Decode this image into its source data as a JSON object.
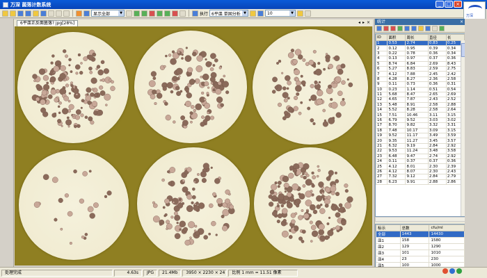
{
  "window": {
    "title": "万深 菌落计数系统",
    "logo_text": "万深"
  },
  "toolbar": {
    "mode_dropdown": "显示全部",
    "run_label": "执行",
    "detect_dropdown": "6平皿 单固分析",
    "num_input": "10"
  },
  "document_tab": {
    "label": "6平皿正反面菌落? jpg[28%]"
  },
  "right_panel": {
    "title": "统计",
    "table1": {
      "columns": [
        "ID",
        "面积",
        "周长",
        "直径",
        "长"
      ],
      "rows": [
        [
          "1",
          "0.53",
          "2.74",
          "0.83",
          "0.25"
        ],
        [
          "2",
          "0.12",
          "0.95",
          "0.39",
          "0.34"
        ],
        [
          "3",
          "0.22",
          "0.78",
          "0.36",
          "0.34"
        ],
        [
          "4",
          "0.13",
          "0.97",
          "0.37",
          "0.36"
        ],
        [
          "5",
          "8.74",
          "6.84",
          "2.69",
          "8.43"
        ],
        [
          "6",
          "5.27",
          "8.83",
          "2.59",
          "2.75"
        ],
        [
          "7",
          "4.12",
          "7.88",
          "2.45",
          "2.42"
        ],
        [
          "8",
          "4.28",
          "8.27",
          "2.36",
          "2.58"
        ],
        [
          "9",
          "0.11",
          "0.73",
          "0.36",
          "0.31"
        ],
        [
          "10",
          "0.23",
          "1.14",
          "0.51",
          "0.54"
        ],
        [
          "11",
          "5.68",
          "8.47",
          "2.65",
          "2.69"
        ],
        [
          "12",
          "4.65",
          "7.87",
          "2.43",
          "2.52"
        ],
        [
          "13",
          "5.48",
          "8.91",
          "2.58",
          "2.88"
        ],
        [
          "14",
          "5.52",
          "8.28",
          "2.58",
          "2.64"
        ],
        [
          "15",
          "7.51",
          "10.46",
          "3.11",
          "3.15"
        ],
        [
          "16",
          "6.79",
          "9.52",
          "3.03",
          "3.02"
        ],
        [
          "17",
          "8.70",
          "9.82",
          "3.32",
          "3.31"
        ],
        [
          "18",
          "7.48",
          "10.17",
          "3.09",
          "3.15"
        ],
        [
          "19",
          "9.52",
          "11.17",
          "3.49",
          "3.59"
        ],
        [
          "20",
          "9.35",
          "11.27",
          "3.45",
          "3.57"
        ],
        [
          "21",
          "6.32",
          "9.19",
          "2.84",
          "2.92"
        ],
        [
          "22",
          "9.53",
          "11.24",
          "3.48",
          "3.58"
        ],
        [
          "23",
          "6.48",
          "9.47",
          "2.74",
          "2.92"
        ],
        [
          "24",
          "0.11",
          "0.37",
          "0.37",
          "0.36"
        ],
        [
          "25",
          "4.12",
          "8.01",
          "2.30",
          "2.39"
        ],
        [
          "26",
          "4.12",
          "8.07",
          "2.30",
          "2.43"
        ],
        [
          "27",
          "7.32",
          "9.12",
          "2.84",
          "2.79"
        ],
        [
          "28",
          "6.23",
          "9.91",
          "2.88",
          "2.86"
        ]
      ]
    },
    "table2": {
      "columns": [
        "标示",
        "总数",
        "cfu/ml"
      ],
      "rows": [
        [
          "全部",
          "1443",
          "14430"
        ],
        [
          "皿1",
          "158",
          "1580"
        ],
        [
          "皿2",
          "129",
          "1290"
        ],
        [
          "皿3",
          "101",
          "1010"
        ],
        [
          "皿4",
          "23",
          "230"
        ],
        [
          "皿5",
          "100",
          "1000"
        ],
        [
          "皿6",
          "181",
          "1810"
        ]
      ]
    },
    "tabs": [
      "分类",
      "结果"
    ]
  },
  "status_bar": {
    "message": "处理完成",
    "time": "4.63s",
    "format": "JPG",
    "filesize": "21.4Mb",
    "dimensions": "3950 × 2230 × 24",
    "scale": "比例 1 mm = 11.51 像素"
  },
  "colors": {
    "canvas_bg": "#8f7f22",
    "dish_rim": "#e4d35a",
    "colony_dark": "#8a6a5a",
    "colony_light": "#c8a898",
    "selection": "#316ac5"
  },
  "dishes": [
    {
      "id": "dish-1",
      "colony_count": 158
    },
    {
      "id": "dish-2",
      "colony_count": 129
    },
    {
      "id": "dish-3",
      "colony_count": 101
    },
    {
      "id": "dish-4",
      "colony_count": 23
    },
    {
      "id": "dish-5",
      "colony_count": 100
    },
    {
      "id": "dish-6",
      "colony_count": 181
    }
  ]
}
